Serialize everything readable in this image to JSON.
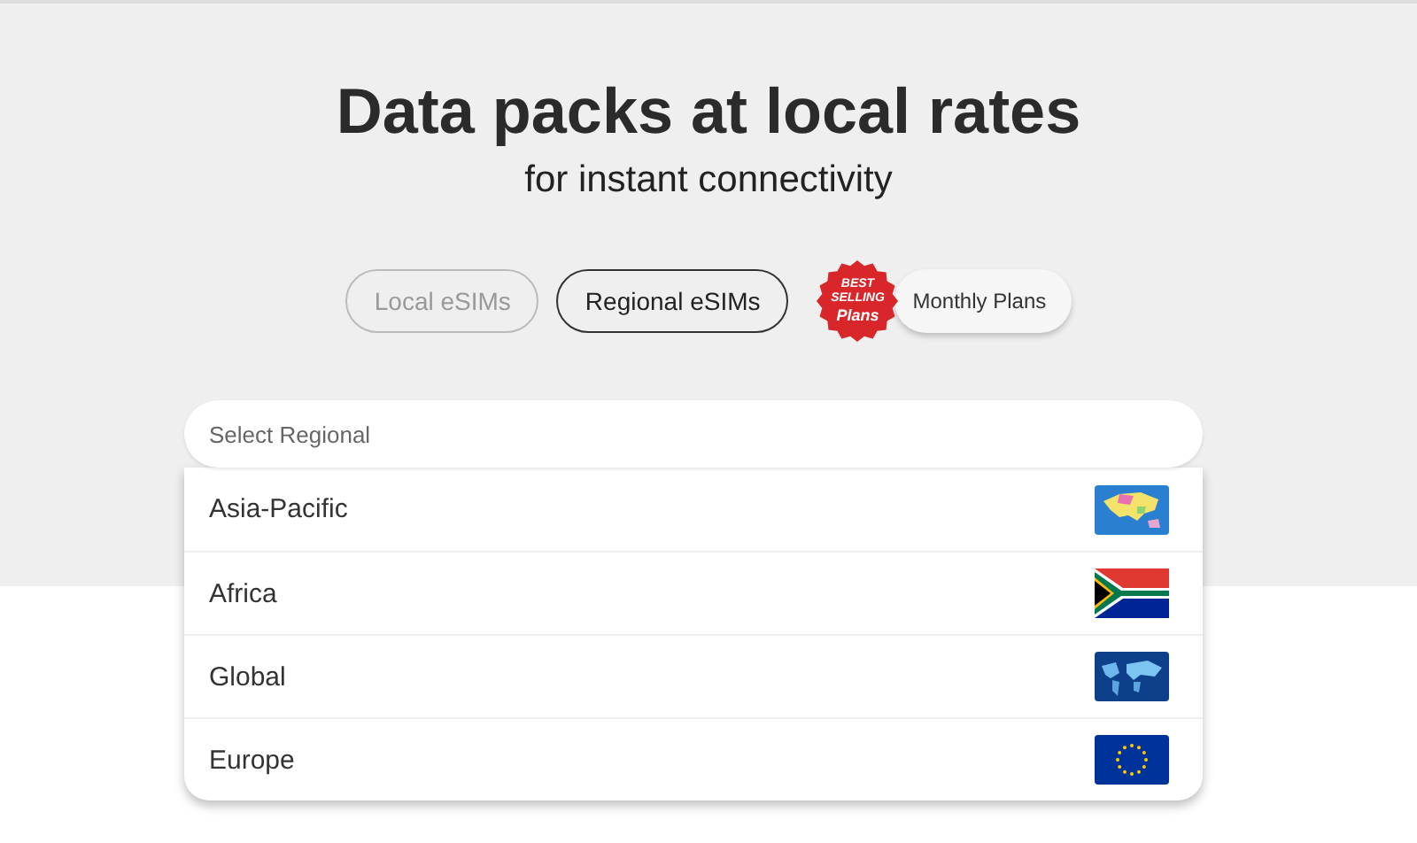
{
  "hero": {
    "title": "Data packs at local rates",
    "subtitle": "for instant connectivity"
  },
  "tabs": [
    {
      "label": "Local eSIMs",
      "selected": false,
      "kind": "plain"
    },
    {
      "label": "Regional eSIMs",
      "selected": true,
      "kind": "plain"
    },
    {
      "label": "Monthly Plans",
      "selected": false,
      "kind": "badged",
      "badge": [
        "BEST",
        "SELLING",
        "Plans"
      ]
    }
  ],
  "select": {
    "placeholder": "Select Regional",
    "expanded": true
  },
  "options": [
    {
      "label": "Asia-Pacific"
    },
    {
      "label": "Africa"
    },
    {
      "label": "Global"
    },
    {
      "label": "Europe"
    }
  ]
}
